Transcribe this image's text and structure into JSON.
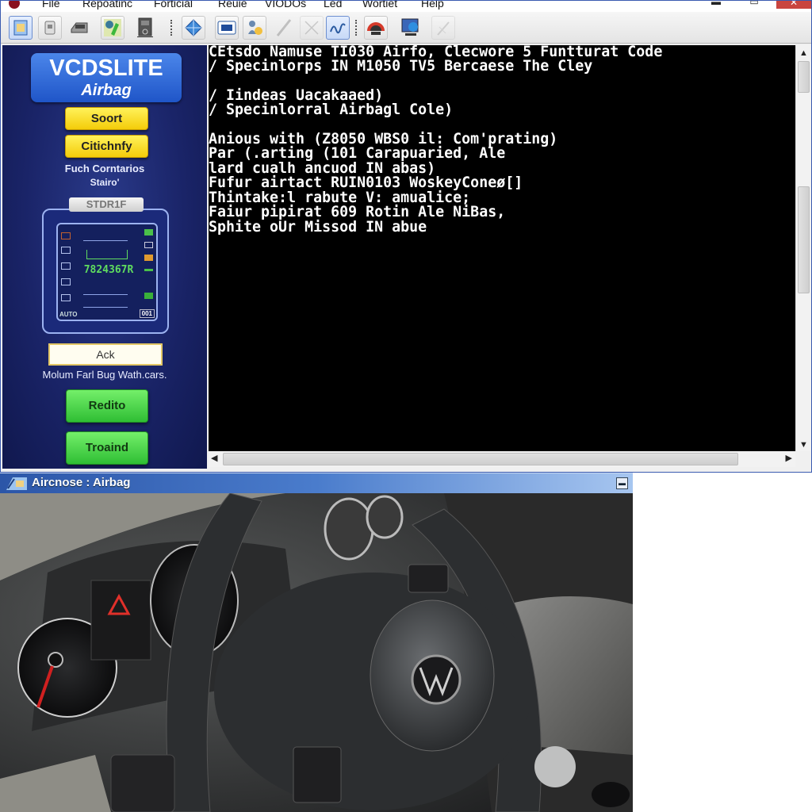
{
  "app": {
    "menu": [
      "File",
      "Repoatinc",
      "Forticial",
      "Reuie",
      "VIODOs",
      "Led",
      "Wortiet",
      "Help"
    ],
    "window_controls": {
      "minimize": "▬",
      "maximize": "▭",
      "close": "✕"
    },
    "toolbar": [
      {
        "icon": "document-icon",
        "state": "active"
      },
      {
        "icon": "clipboard-icon",
        "state": "normal"
      },
      {
        "icon": "printer-icon",
        "state": "normal"
      },
      {
        "icon": "diagnostic-tool-icon",
        "state": "normal"
      },
      {
        "icon": "device-icon",
        "state": "normal"
      },
      {
        "icon": "globe-icon",
        "state": "normal"
      },
      {
        "icon": "id-card-icon",
        "state": "normal"
      },
      {
        "icon": "user-search-icon",
        "state": "normal"
      },
      {
        "icon": "pen-icon",
        "state": "disabled"
      },
      {
        "icon": "cancel-icon",
        "state": "disabled"
      },
      {
        "icon": "signature-icon",
        "state": "active"
      },
      {
        "icon": "gauge-icon",
        "state": "normal"
      },
      {
        "icon": "network-icon",
        "state": "normal"
      },
      {
        "icon": "tool-icon",
        "state": "disabled"
      }
    ]
  },
  "left_panel": {
    "logo_title": "VCDSLITE",
    "logo_subtitle": "Airbag",
    "button_1": "Soort",
    "button_2": "Citichnfy",
    "info_line_1": "Fuch Corntarios",
    "info_line_2": "Stairo'",
    "device_label": "STDR1F",
    "device_code": "7824367R",
    "device_bottom_left": "AUTO",
    "device_bottom_right": "001",
    "ack_field_value": "Ack",
    "status_text": "Molum Farl Bug Wath.cars.",
    "button_3": "Redito",
    "button_4": "Troaind"
  },
  "console": {
    "lines": [
      "CEtsdo Namuse TI030 Airfo, Clecwore 5 Funtturat Code",
      "/ Specinlorps IN M1050 TV5 Bercaese The Cley",
      "",
      "/ Iindeas Uacakaaed)",
      "/ Specinlorral Airbagl Cole)",
      "",
      "Anious with (Z8050 WBS0 il: Com'prating)",
      "Par (.arting (101 Carapuaried, Ale",
      "lard cualh ancuod IN abas)",
      "Fufur airtact RUIN0103 WoskeyConeø[]",
      "Thintake:l rabute V: amualice;",
      "Faiur pipirat 609 Rotin Ale NiBas,",
      "Sphite oUr Missod IN abue"
    ]
  },
  "scrollbars": {
    "up": "▲",
    "down": "▼",
    "left": "◀",
    "right": "▶"
  },
  "photo_window": {
    "title": "Aircnose : Airbag",
    "minimize": "▬",
    "image_description": "Car interior with steering wheel, VW logo airbag, instrument cluster showing warning triangle"
  }
}
